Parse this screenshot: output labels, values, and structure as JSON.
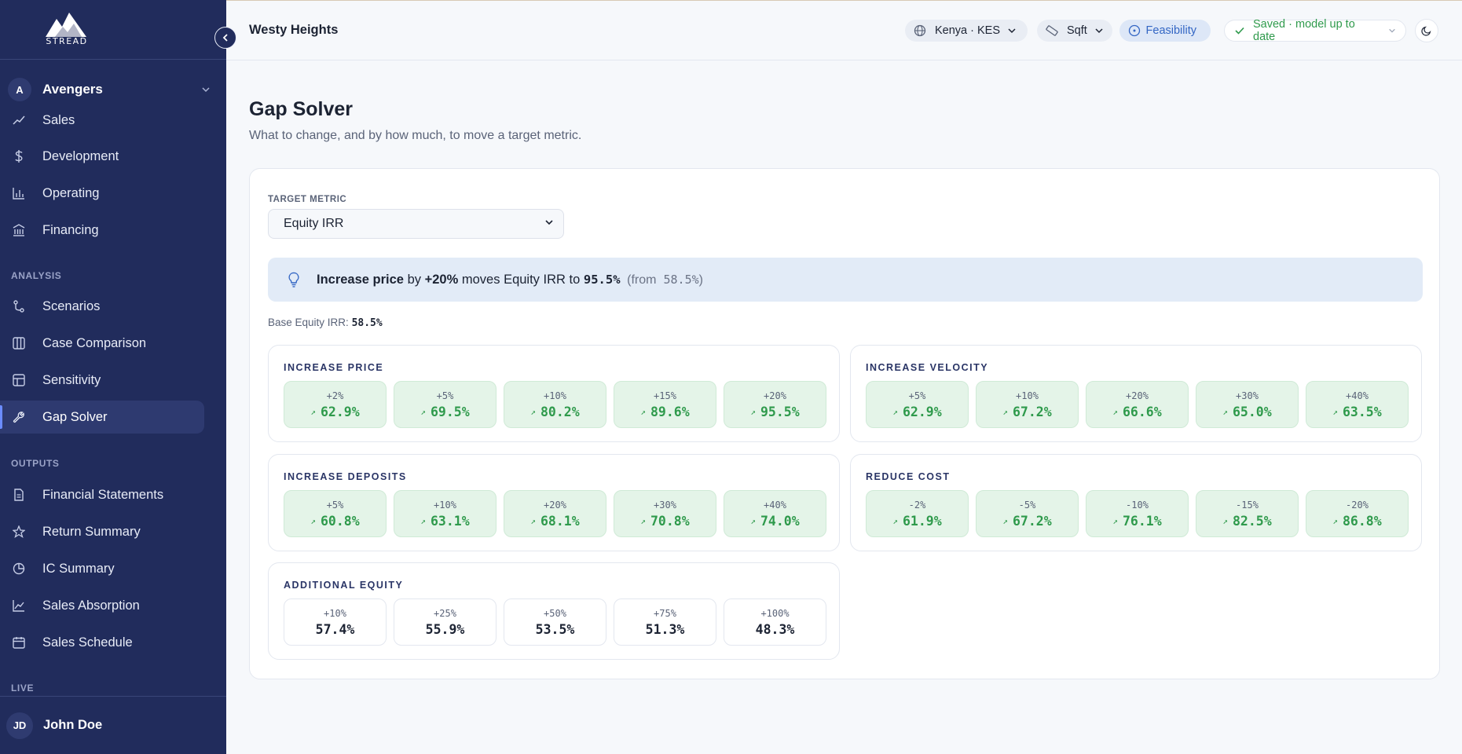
{
  "app": {
    "logo_text": "STREAD"
  },
  "workspace": {
    "initial": "A",
    "name": "Avengers"
  },
  "sidebar": {
    "partial_item": "Sales",
    "build_items": [
      "Development",
      "Operating",
      "Financing"
    ],
    "analysis_label": "ANALYSIS",
    "analysis_items": [
      "Scenarios",
      "Case Comparison",
      "Sensitivity",
      "Gap Solver"
    ],
    "outputs_label": "OUTPUTS",
    "outputs_items": [
      "Financial Statements",
      "Return Summary",
      "IC Summary",
      "Sales Absorption",
      "Sales Schedule"
    ],
    "live_label": "LIVE"
  },
  "user": {
    "initials": "JD",
    "name": "John Doe"
  },
  "topbar": {
    "project": "Westy Heights",
    "currency": "Kenya · KES",
    "unit": "Sqft",
    "stage": "Feasibility",
    "status": "Saved · model up to date"
  },
  "page": {
    "title": "Gap Solver",
    "subtitle": "What to change, and by how much, to move a target metric."
  },
  "solver": {
    "target_label": "TARGET METRIC",
    "target_value": "Equity IRR",
    "insight": {
      "action": "Increase price",
      "by": "by",
      "delta": "+20%",
      "moves": "moves Equity IRR to",
      "result": "95.5%",
      "from_prefix": "(from",
      "from_value": "58.5%",
      "from_suffix": ")"
    },
    "base_label": "Base Equity IRR:",
    "base_value": "58.5%",
    "groups": [
      {
        "title": "INCREASE PRICE",
        "tiles": [
          {
            "label": "+2%",
            "value": "62.9%"
          },
          {
            "label": "+5%",
            "value": "69.5%"
          },
          {
            "label": "+10%",
            "value": "80.2%"
          },
          {
            "label": "+15%",
            "value": "89.6%"
          },
          {
            "label": "+20%",
            "value": "95.5%"
          }
        ]
      },
      {
        "title": "INCREASE VELOCITY",
        "tiles": [
          {
            "label": "+5%",
            "value": "62.9%"
          },
          {
            "label": "+10%",
            "value": "67.2%"
          },
          {
            "label": "+20%",
            "value": "66.6%"
          },
          {
            "label": "+30%",
            "value": "65.0%"
          },
          {
            "label": "+40%",
            "value": "63.5%"
          }
        ]
      },
      {
        "title": "INCREASE DEPOSITS",
        "tiles": [
          {
            "label": "+5%",
            "value": "60.8%"
          },
          {
            "label": "+10%",
            "value": "63.1%"
          },
          {
            "label": "+20%",
            "value": "68.1%"
          },
          {
            "label": "+30%",
            "value": "70.8%"
          },
          {
            "label": "+40%",
            "value": "74.0%"
          }
        ]
      },
      {
        "title": "REDUCE COST",
        "tiles": [
          {
            "label": "-2%",
            "value": "61.9%"
          },
          {
            "label": "-5%",
            "value": "67.2%"
          },
          {
            "label": "-10%",
            "value": "76.1%"
          },
          {
            "label": "-15%",
            "value": "82.5%"
          },
          {
            "label": "-20%",
            "value": "86.8%"
          }
        ]
      },
      {
        "title": "ADDITIONAL EQUITY",
        "tiles": [
          {
            "label": "+10%",
            "value": "57.4%"
          },
          {
            "label": "+25%",
            "value": "55.9%"
          },
          {
            "label": "+50%",
            "value": "53.5%"
          },
          {
            "label": "+75%",
            "value": "51.3%"
          },
          {
            "label": "+100%",
            "value": "48.3%"
          }
        ]
      }
    ]
  },
  "colors": {
    "sidebar_bg": "#212c5c",
    "accent": "#3366c4",
    "positive": "#2f9a4c",
    "positive_tile_bg": "#e4f4e8",
    "insight_bg": "#e2ebf7"
  },
  "icons": {
    "sales": "trend-icon",
    "development": "dollar-icon",
    "operating": "bar-chart-icon",
    "financing": "bank-icon",
    "scenarios": "branch-icon",
    "case_comparison": "columns-icon",
    "sensitivity": "grid-icon",
    "gap_solver": "wrench-icon",
    "financial_statements": "document-icon",
    "return_summary": "star-icon",
    "ic_summary": "pie-icon",
    "sales_absorption": "line-chart-icon",
    "sales_schedule": "calendar-icon"
  }
}
